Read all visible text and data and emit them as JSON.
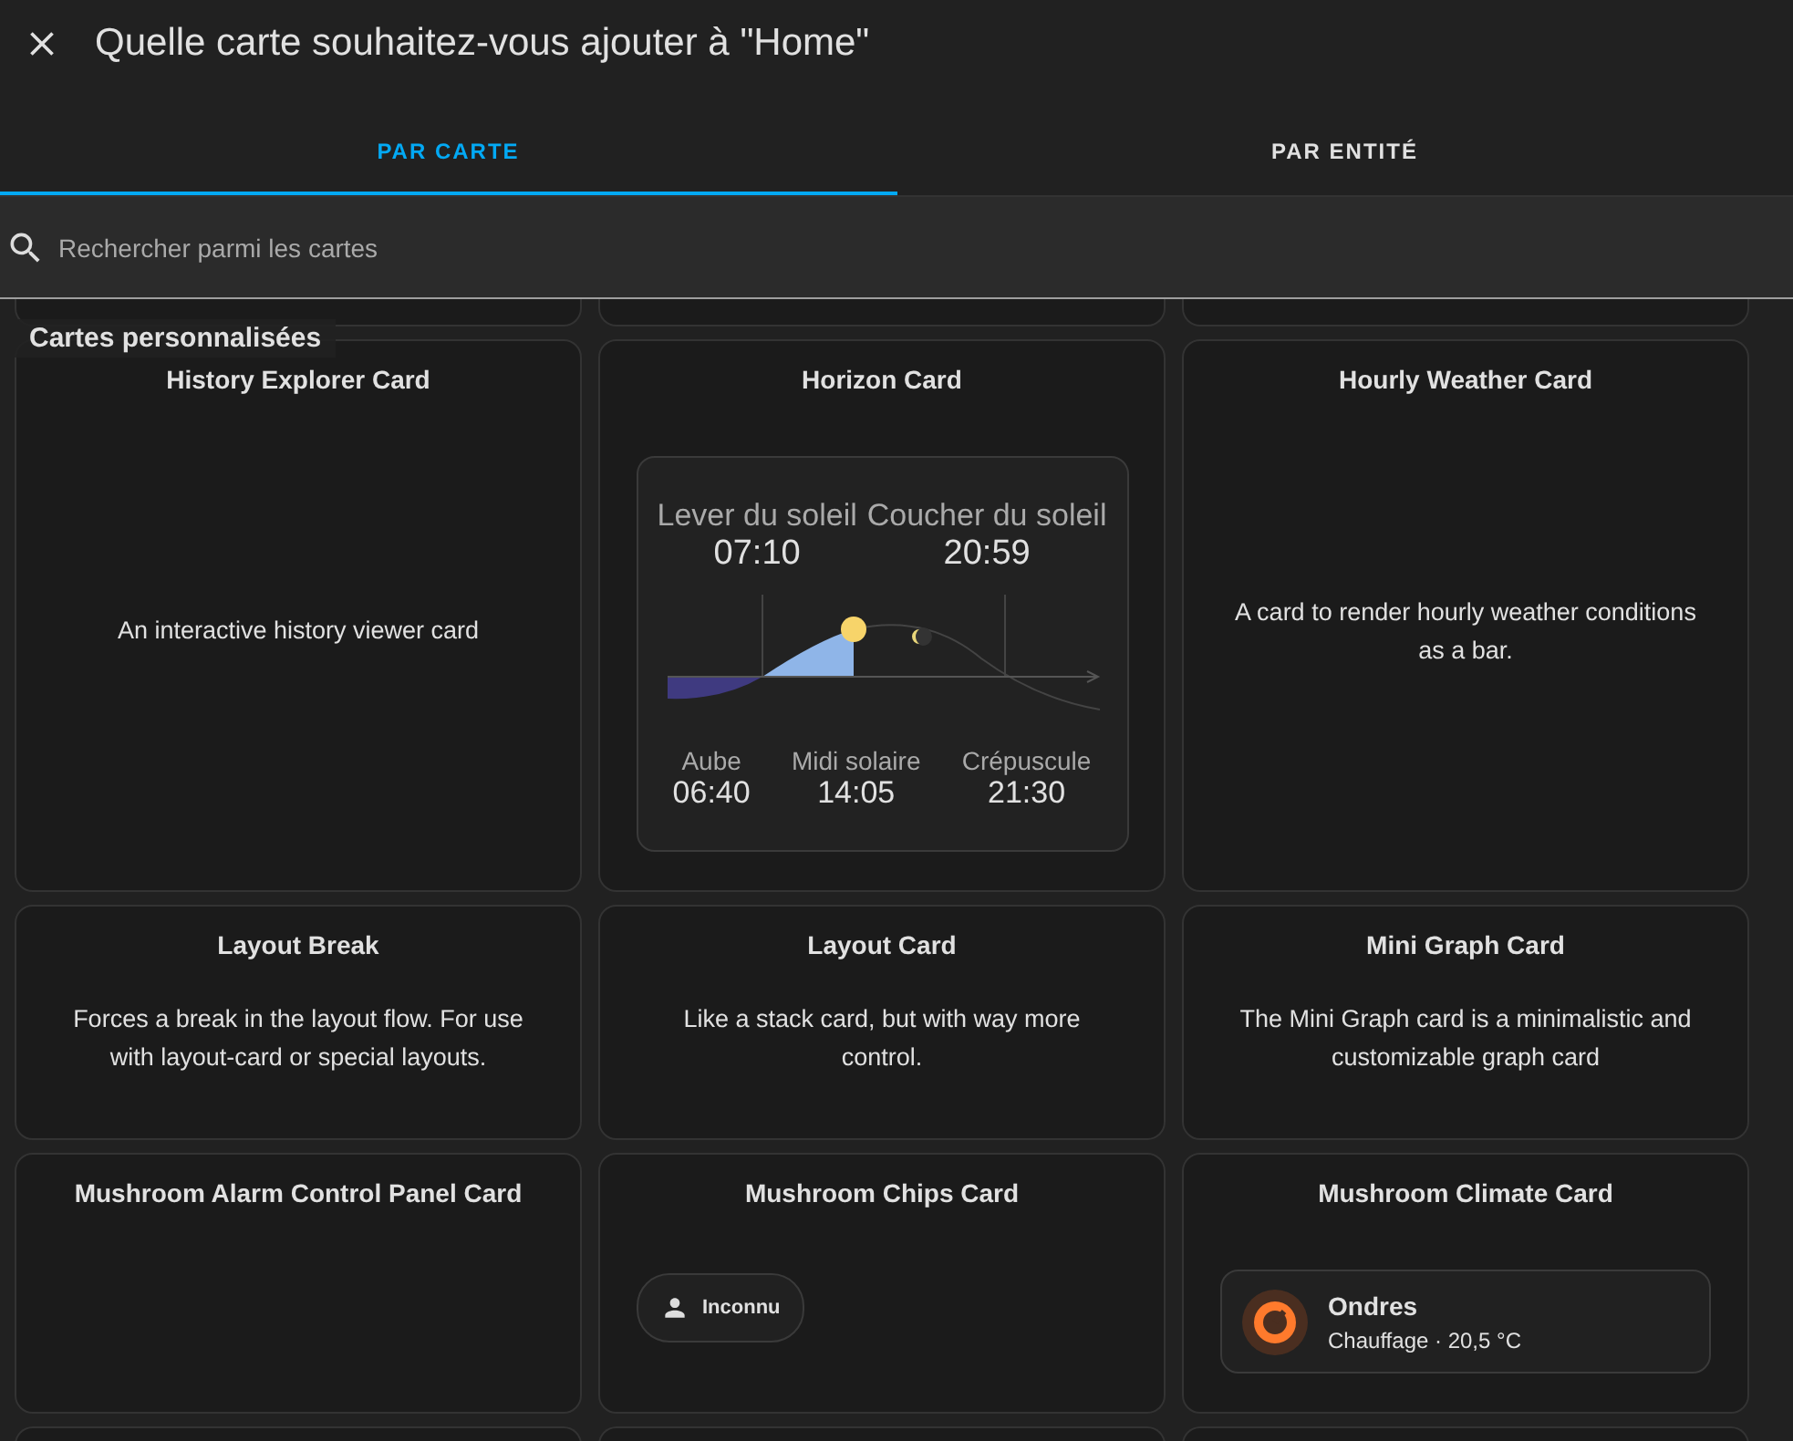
{
  "dialog": {
    "title": "Quelle carte souhaitez-vous ajouter à \"Home\""
  },
  "tabs": [
    {
      "label": "PAR CARTE",
      "selected": true
    },
    {
      "label": "PAR ENTITÉ",
      "selected": false
    }
  ],
  "search": {
    "placeholder": "Rechercher parmi les cartes"
  },
  "section": {
    "title": "Cartes personnalisées"
  },
  "cards": [
    {
      "kind": "text",
      "title": "History Explorer Card",
      "description": "An interactive history viewer card"
    },
    {
      "kind": "horizon",
      "title": "Horizon Card",
      "sunrise_label": "Lever du soleil",
      "sunrise": "07:10",
      "sunset_label": "Coucher du soleil",
      "sunset": "20:59",
      "times": [
        {
          "label": "Aube",
          "value": "06:40"
        },
        {
          "label": "Midi solaire",
          "value": "14:05"
        },
        {
          "label": "Crépuscule",
          "value": "21:30"
        }
      ]
    },
    {
      "kind": "text",
      "title": "Hourly Weather Card",
      "description": "A card to render hourly weather conditions as a bar."
    },
    {
      "kind": "text",
      "title": "Layout Break",
      "description": "Forces a break in the layout flow. For use with layout-card or special layouts."
    },
    {
      "kind": "text",
      "title": "Layout Card",
      "description": "Like a stack card, but with way more control."
    },
    {
      "kind": "text",
      "title": "Mini Graph Card",
      "description": "The Mini Graph card is a minimalistic and customizable graph card"
    },
    {
      "kind": "text",
      "title": "Mushroom Alarm Control Panel Card"
    },
    {
      "kind": "chips",
      "title": "Mushroom Chips Card",
      "chip": "Inconnu"
    },
    {
      "kind": "climate",
      "title": "Mushroom Climate Card",
      "name": "Ondres",
      "state": "Chauffage · 20,5 °C"
    }
  ]
}
